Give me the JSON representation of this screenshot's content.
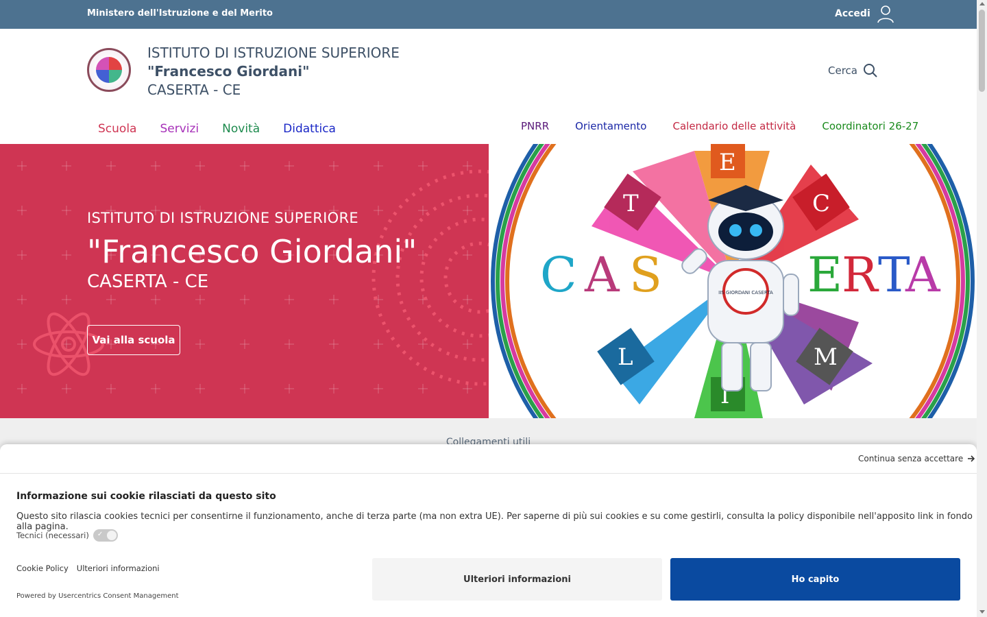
{
  "topbar": {
    "ministry": "Ministero dell'Istruzione e del Merito",
    "login_label": "Accedi",
    "background": "#4d7290"
  },
  "header": {
    "line1": "ISTITUTO DI ISTRUZIONE SUPERIORE",
    "line2": "\"Francesco Giordani\"",
    "line3": "CASERTA - CE",
    "search_label": "Cerca"
  },
  "nav": {
    "main": [
      {
        "label": "Scuola",
        "color": "#cf3553"
      },
      {
        "label": "Servizi",
        "color": "#a62fb8"
      },
      {
        "label": "Novità",
        "color": "#1d8a4d"
      },
      {
        "label": "Didattica",
        "color": "#1a27c6"
      }
    ],
    "secondary": [
      {
        "label": "PNRR",
        "color": "#5a1a7a"
      },
      {
        "label": "Orientamento",
        "color": "#1a27a6"
      },
      {
        "label": "Calendario delle attività",
        "color": "#c32843"
      },
      {
        "label": "Coordinatori 26-27",
        "color": "#198a1c"
      }
    ]
  },
  "hero": {
    "line1": "ISTITUTO DI ISTRUZIONE SUPERIORE",
    "line2": "\"Francesco Giordani\"",
    "line3": "CASERTA - CE",
    "button_label": "Vai alla scuola",
    "background": "#cf3553",
    "image_letters": [
      "C",
      "A",
      "S",
      "E",
      "R",
      "T",
      "A"
    ],
    "image_badge": "IIS GIORDANI CASERTA"
  },
  "links_strip": {
    "title": "Collegamenti utili"
  },
  "cookie": {
    "continue_label": "Continua senza accettare",
    "heading": "Informazione sui cookie rilasciati da questo sito",
    "description": "Questo sito rilascia cookies tecnici per consentirne il funzionamento, anche di terza parte (ma non extra UE). Per saperne di più sui cookies e su come gestirli, consulta la policy disponibile nell'apposito link in fondo alla pagina.",
    "toggle_label": "Tecnici (necessari)",
    "link_policy": "Cookie Policy",
    "link_more": "Ulteriori informazioni",
    "powered": "Powered by Usercentrics Consent Management",
    "btn_more": "Ulteriori informazioni",
    "btn_ok": "Ho capito",
    "ok_color": "#0a4aa0"
  }
}
